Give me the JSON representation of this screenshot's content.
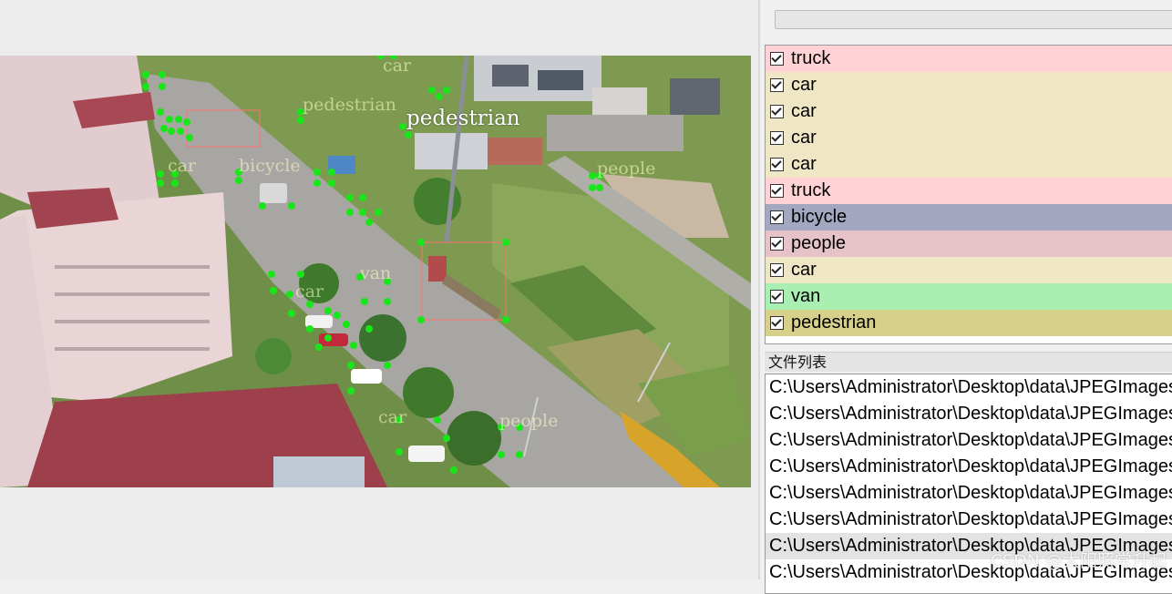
{
  "canvas": {
    "annotation_labels": [
      "car",
      "pedestrian",
      "pedestrian",
      "car",
      "bicycle",
      "van",
      "car",
      "people",
      "car",
      "people"
    ]
  },
  "label_list": {
    "items": [
      {
        "label": "truck",
        "checked": true,
        "color": "#ffd2d6"
      },
      {
        "label": "car",
        "checked": true,
        "color": "#efe6c6"
      },
      {
        "label": "car",
        "checked": true,
        "color": "#efe6c6"
      },
      {
        "label": "car",
        "checked": true,
        "color": "#efe6c6"
      },
      {
        "label": "car",
        "checked": true,
        "color": "#efe6c6"
      },
      {
        "label": "truck",
        "checked": true,
        "color": "#ffd2d6"
      },
      {
        "label": "bicycle",
        "checked": true,
        "color": "#a3a7bf"
      },
      {
        "label": "people",
        "checked": true,
        "color": "#e6c3c9"
      },
      {
        "label": "car",
        "checked": true,
        "color": "#efe6c6"
      },
      {
        "label": "van",
        "checked": true,
        "color": "#a8efb1"
      },
      {
        "label": "pedestrian",
        "checked": true,
        "color": "#d6d08a"
      }
    ]
  },
  "file_list": {
    "title": "文件列表",
    "files": [
      "C:\\Users\\Administrator\\Desktop\\data\\JPEGImages",
      "C:\\Users\\Administrator\\Desktop\\data\\JPEGImages",
      "C:\\Users\\Administrator\\Desktop\\data\\JPEGImages",
      "C:\\Users\\Administrator\\Desktop\\data\\JPEGImages",
      "C:\\Users\\Administrator\\Desktop\\data\\JPEGImages",
      "C:\\Users\\Administrator\\Desktop\\data\\JPEGImages",
      "C:\\Users\\Administrator\\Desktop\\data\\JPEGImages",
      "C:\\Users\\Administrator\\Desktop\\data\\JPEGImages"
    ],
    "selected_index": 6
  },
  "watermark": "CSDN @太阳照常升起",
  "colors": {
    "vertex": "#19e619",
    "box": "#ff6666"
  }
}
